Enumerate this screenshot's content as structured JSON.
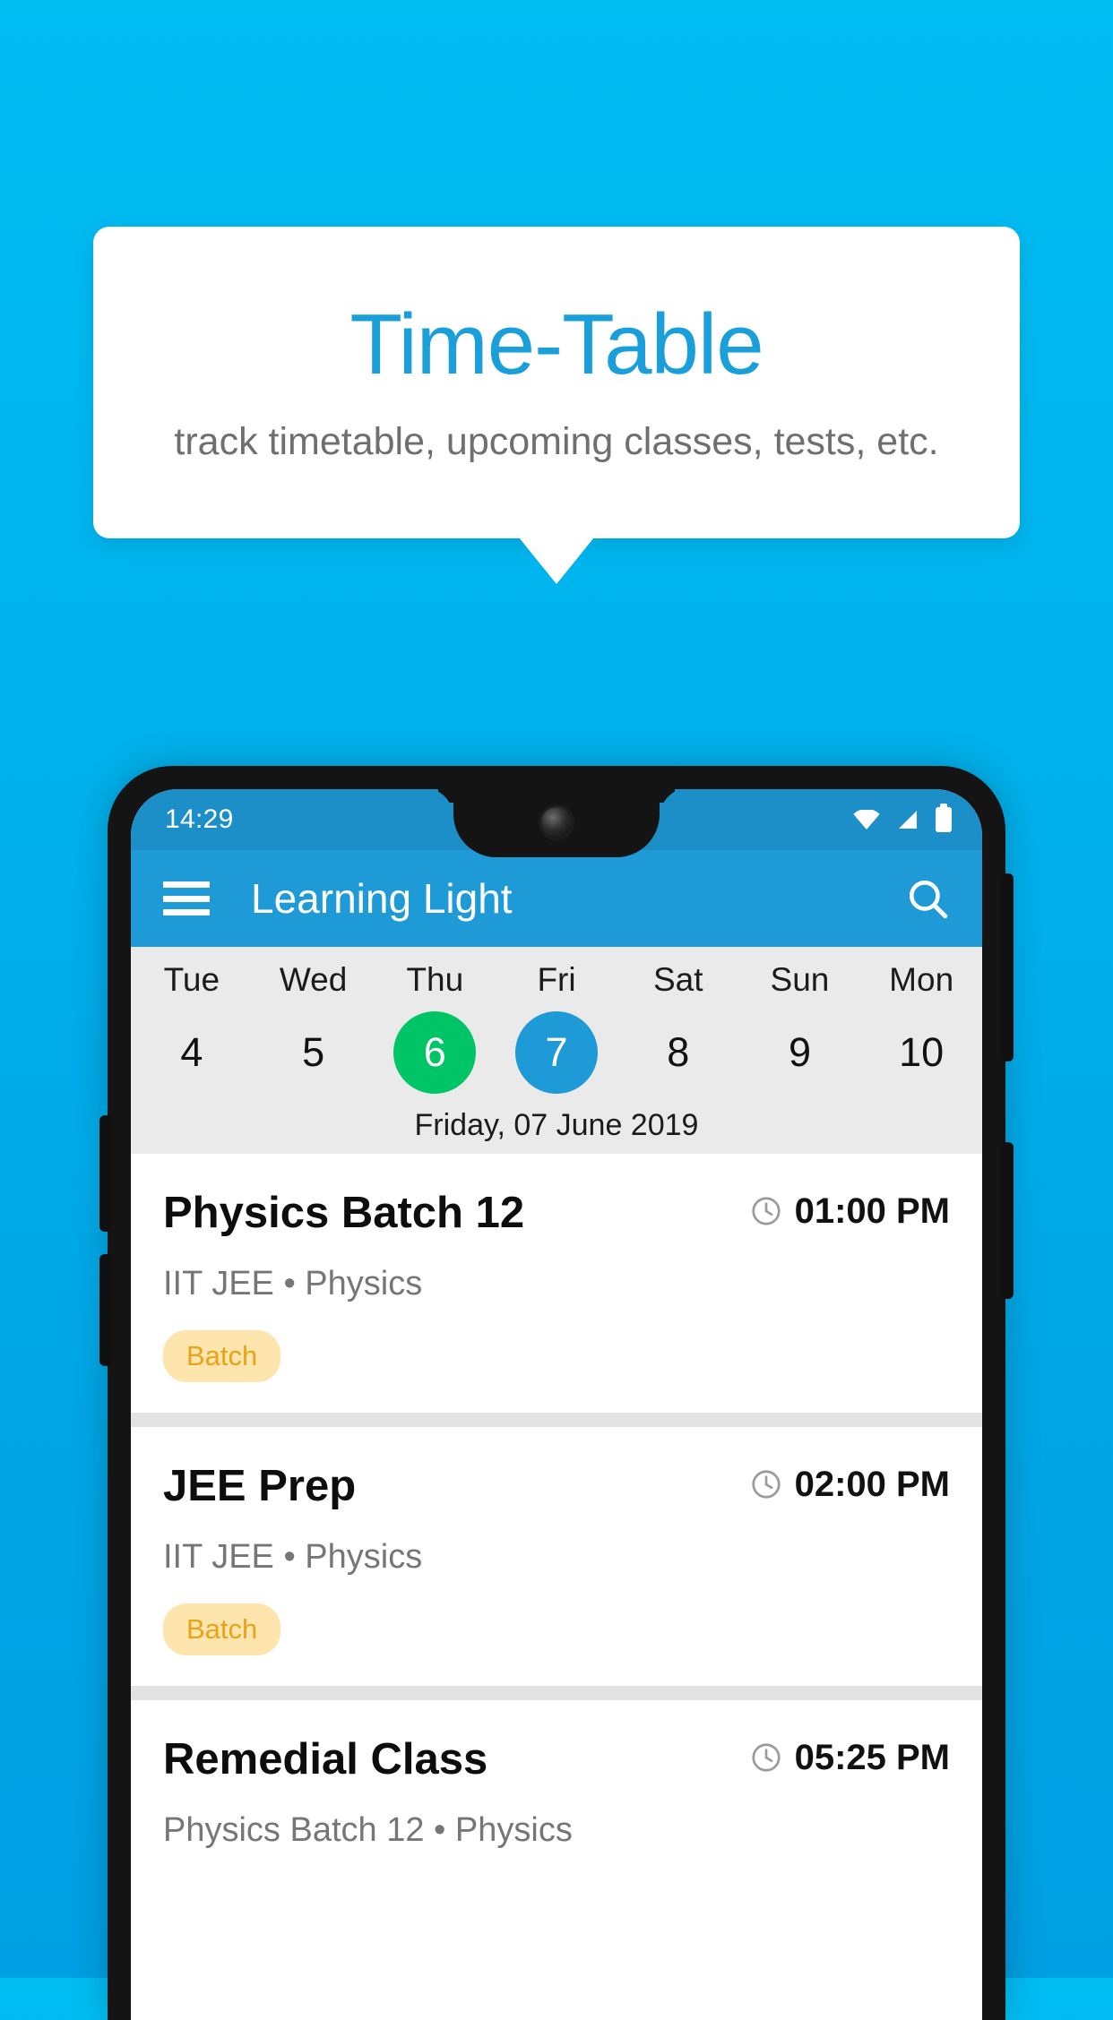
{
  "callout": {
    "title": "Time-Table",
    "subtitle": "track timetable, upcoming classes, tests, etc."
  },
  "phone": {
    "statusbar": {
      "time": "14:29",
      "icons": [
        "wifi-icon",
        "signal-icon",
        "battery-icon"
      ]
    },
    "appbar": {
      "menu_icon": "hamburger-menu-icon",
      "title": "Learning Light",
      "search_icon": "search-icon"
    },
    "daystrip": {
      "days": [
        {
          "name": "Tue",
          "num": "4",
          "state": "none"
        },
        {
          "name": "Wed",
          "num": "5",
          "state": "none"
        },
        {
          "name": "Thu",
          "num": "6",
          "state": "green"
        },
        {
          "name": "Fri",
          "num": "7",
          "state": "blue"
        },
        {
          "name": "Sat",
          "num": "8",
          "state": "none"
        },
        {
          "name": "Sun",
          "num": "9",
          "state": "none"
        },
        {
          "name": "Mon",
          "num": "10",
          "state": "none"
        }
      ],
      "date_label": "Friday, 07 June 2019"
    },
    "cards": [
      {
        "title": "Physics Batch 12",
        "time": "01:00 PM",
        "subtitle": "IIT JEE • Physics",
        "chip": "Batch"
      },
      {
        "title": "JEE Prep",
        "time": "02:00 PM",
        "subtitle": "IIT JEE • Physics",
        "chip": "Batch"
      },
      {
        "title": "Remedial Class",
        "time": "05:25 PM",
        "subtitle": "Physics Batch 12 • Physics",
        "chip": ""
      }
    ]
  },
  "colors": {
    "background_blue": "#00b2ec",
    "title_blue": "#1a9fdb",
    "appbar_blue": "#1e9ad6",
    "statusbar_blue": "#1c8fc9",
    "today_green": "#00c566",
    "selected_blue": "#1e9ad6",
    "chip_bg": "#fde5ad",
    "chip_text": "#e8a317",
    "daystrip_bg": "#eaeaea"
  }
}
